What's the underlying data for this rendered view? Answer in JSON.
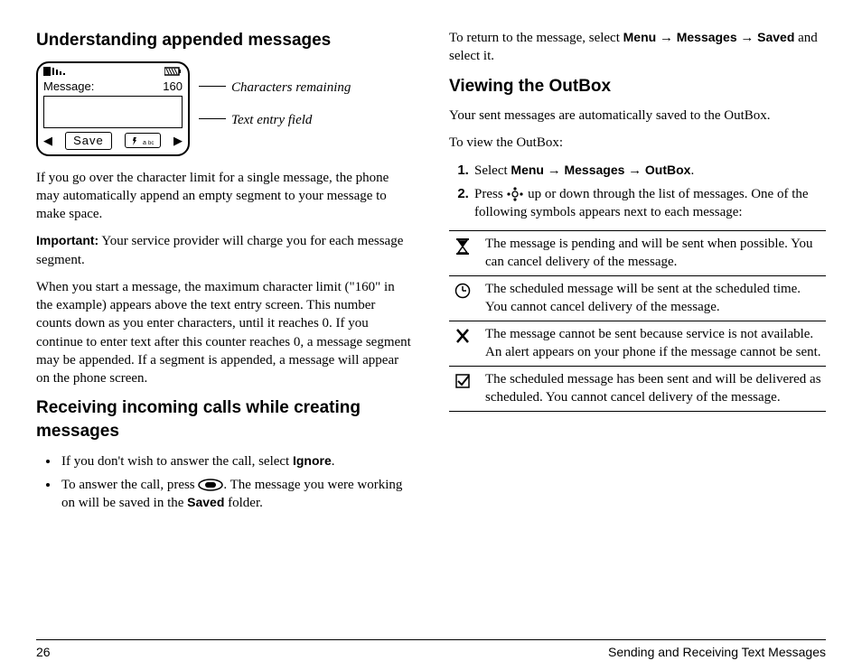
{
  "col1": {
    "h1": "Understanding appended messages",
    "phone": {
      "message_label": "Message:",
      "char_count": "160",
      "save_label": "Save"
    },
    "callout1": "Characters remaining",
    "callout2": "Text entry field",
    "p1": "If you go over the character limit for a single message, the phone may automatically append an empty segment to your message to make space.",
    "important_label": "Important:",
    "important_text": "Your service provider will charge you for each message segment.",
    "p2": "When you start a message, the maximum character limit (\"160\" in the example) appears above the text entry screen. This number counts down as you enter characters, until it reaches 0. If you continue to enter text after this counter reaches 0, a message segment may be appended. If a segment is appended, a message will appear on the phone screen.",
    "h2": "Receiving incoming calls while creating messages",
    "bullet1_a": "If you don't wish to answer the call, select ",
    "bullet1_b": "Ignore",
    "bullet1_c": ".",
    "bullet2_a": "To answer the call, press ",
    "bullet2_b": ". The message you were working on will be saved in the ",
    "bullet2_c": "Saved",
    "bullet2_d": " folder."
  },
  "col2": {
    "intro_a": "To return to the message, select ",
    "intro_menu": "Menu",
    "arrow": " → ",
    "intro_messages": "Messages",
    "intro_saved": "Saved",
    "intro_b": " and select it.",
    "h1": "Viewing the OutBox",
    "p1": "Your sent messages are automatically saved to the OutBox.",
    "p2": "To view the OutBox:",
    "step1_a": "Select ",
    "step1_menu": "Menu",
    "step1_messages": "Messages",
    "step1_outbox": "OutBox",
    "step1_b": ".",
    "step2_a": "Press ",
    "step2_b": " up or down through the list of messages. One of the following symbols appears next to each message:",
    "sym1": "The message is pending and will be sent when possible. You can cancel delivery of the message.",
    "sym2": "The scheduled message will be sent at the scheduled time. You cannot cancel delivery of the message.",
    "sym3": "The message cannot be sent because service is not available. An alert appears on your phone if the message cannot be sent.",
    "sym4": "The scheduled message has been sent and will be delivered as scheduled. You cannot cancel delivery of the message."
  },
  "footer": {
    "page": "26",
    "title": "Sending and Receiving Text Messages"
  }
}
